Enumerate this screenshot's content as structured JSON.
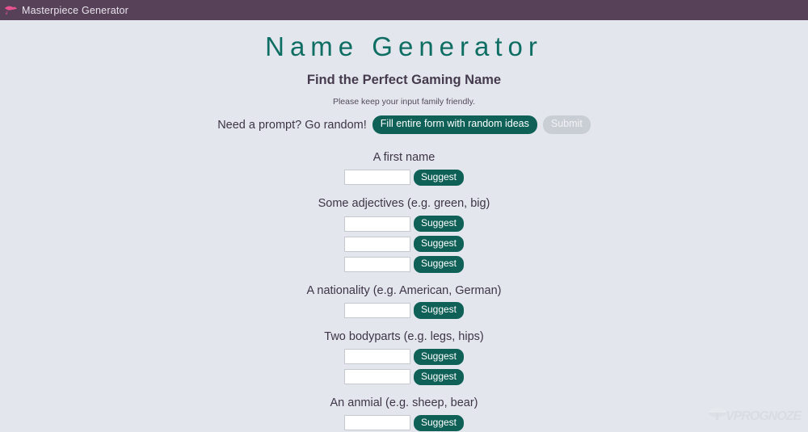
{
  "window": {
    "title": "Masterpiece Generator",
    "icon": "pink-blob-icon",
    "titlebar_color": "#574159"
  },
  "page": {
    "background_color": "#e3e7ed",
    "title": "Name Generator",
    "subtitle": "Find the Perfect Gaming Name",
    "note": "Please keep your input family friendly.",
    "accent_color": "#0f6158",
    "title_color": "#0f6e63"
  },
  "prompt": {
    "text": "Need a prompt? Go random!",
    "random_button": "Fill entire form with random ideas",
    "submit_button": "Submit",
    "submit_disabled": true
  },
  "form": {
    "suggest_label": "Suggest",
    "input_placeholder": "",
    "groups": [
      {
        "label": "A first name",
        "inputs": [
          {
            "value": ""
          }
        ]
      },
      {
        "label": "Some adjectives (e.g. green, big)",
        "inputs": [
          {
            "value": ""
          },
          {
            "value": ""
          },
          {
            "value": ""
          }
        ]
      },
      {
        "label": "A nationality (e.g. American, German)",
        "inputs": [
          {
            "value": ""
          }
        ]
      },
      {
        "label": "Two bodyparts (e.g. legs, hips)",
        "inputs": [
          {
            "value": ""
          },
          {
            "value": ""
          }
        ]
      },
      {
        "label": "An anmial (e.g. sheep, bear)",
        "inputs": [
          {
            "value": ""
          }
        ]
      }
    ]
  },
  "watermark": {
    "text": "VPROGNOZE"
  }
}
